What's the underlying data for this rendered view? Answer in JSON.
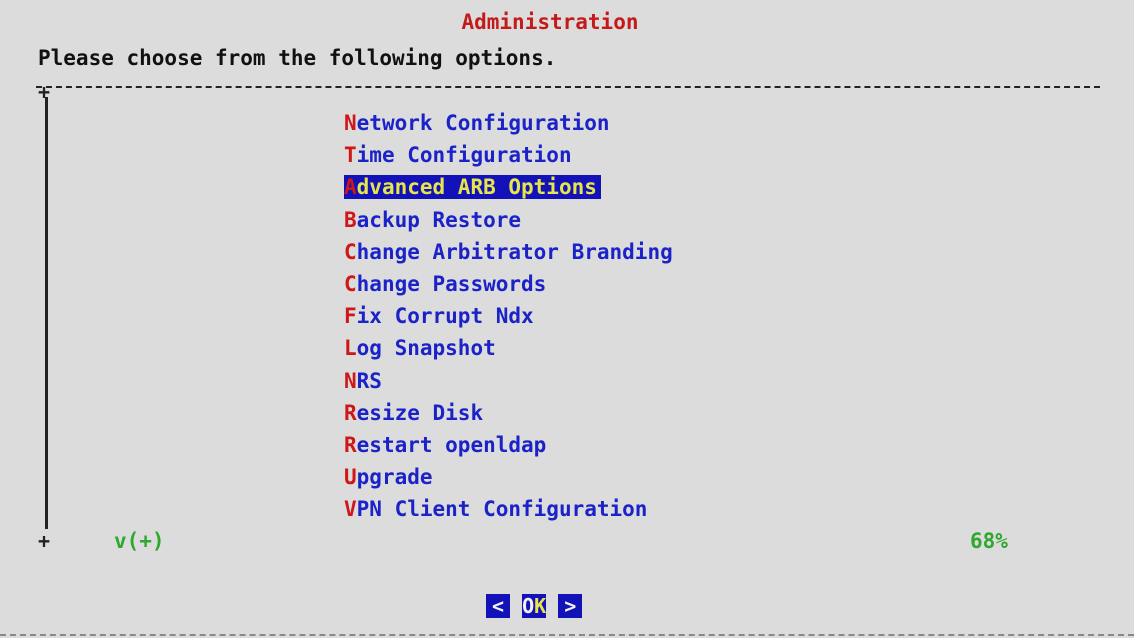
{
  "dialog": {
    "title": "Administration",
    "prompt": "Please choose from the following options.",
    "menu_items": [
      {
        "hot": "N",
        "rest": "etwork Configuration",
        "selected": false
      },
      {
        "hot": "T",
        "rest": "ime Configuration",
        "selected": false
      },
      {
        "hot": "A",
        "rest": "dvanced ARB Options",
        "selected": true
      },
      {
        "hot": "B",
        "rest": "ackup Restore",
        "selected": false
      },
      {
        "hot": "C",
        "rest": "hange Arbitrator Branding",
        "selected": false
      },
      {
        "hot": "C",
        "rest": "hange Passwords",
        "selected": false
      },
      {
        "hot": "F",
        "rest": "ix Corrupt Ndx",
        "selected": false
      },
      {
        "hot": "L",
        "rest": "og Snapshot",
        "selected": false
      },
      {
        "hot": "N",
        "rest": "RS",
        "selected": false
      },
      {
        "hot": "R",
        "rest": "esize Disk",
        "selected": false
      },
      {
        "hot": "R",
        "rest": "estart openldap",
        "selected": false
      },
      {
        "hot": "U",
        "rest": "pgrade",
        "selected": false
      },
      {
        "hot": "V",
        "rest": "PN Client Configuration",
        "selected": false
      }
    ],
    "more_indicator": "v(+)",
    "scroll_percent": "68%",
    "ok_button": {
      "left": "<",
      "o": "O",
      "k": "K",
      "right": ">"
    }
  },
  "colors": {
    "background": "#dcdcdc",
    "title": "#c41a1a",
    "item_text": "#1a22c8",
    "hotkey": "#d01717",
    "selection_bg": "#1212b8",
    "selection_text": "#e6e64a",
    "indicator": "#2ea82e"
  }
}
